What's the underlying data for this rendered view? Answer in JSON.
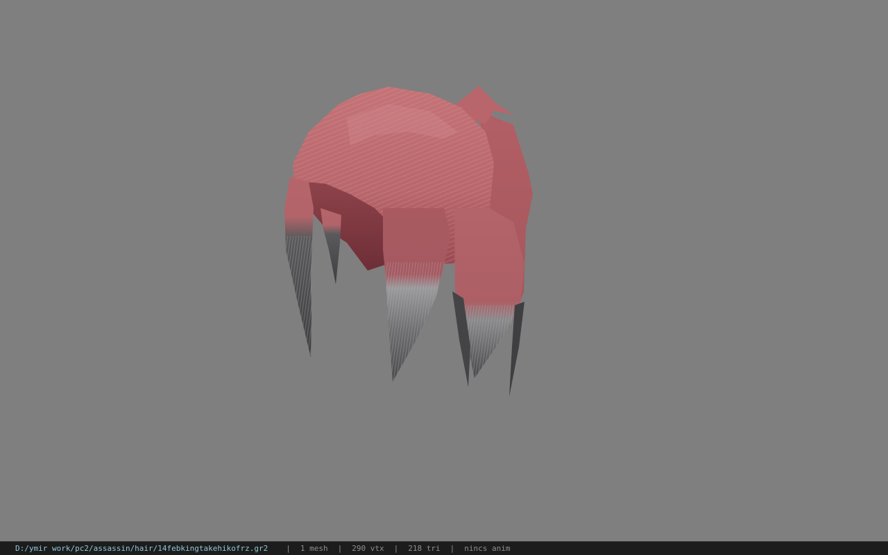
{
  "viewer": {
    "background_color": "#7f7f7f",
    "model_name": "hair mesh"
  },
  "status_bar": {
    "file_path": "D:/ymir work/pc2/assassin/hair/14febkingtakehikofrz.gr2",
    "mesh_count": "1 mesh",
    "vertex_count": "290 vtx",
    "triangle_count": "218 tri",
    "animation": "nincs anim",
    "separator": "|",
    "path_color": "#8ec8d8",
    "text_color": "#8f8f8f"
  }
}
